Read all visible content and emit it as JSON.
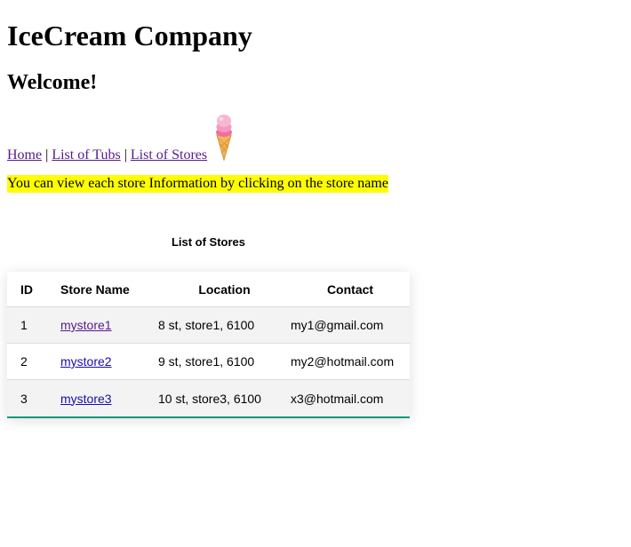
{
  "header": {
    "title": "IceCream Company",
    "welcome": "Welcome!"
  },
  "nav": {
    "home": "Home",
    "sep1": "|",
    "tubs": "List of Tubs",
    "sep2": "|",
    "stores": "List of Stores",
    "logo_icon": "ice-cream-cone-icon"
  },
  "info_text": "You can view each store Information by clicking on the store name",
  "table": {
    "caption": "List of Stores",
    "columns": {
      "id": "ID",
      "name": "Store Name",
      "location": "Location",
      "contact": "Contact"
    },
    "rows": [
      {
        "id": "1",
        "name": "mystore1",
        "location": "8 st, store1, 6100",
        "contact": "my1@gmail.com"
      },
      {
        "id": "2",
        "name": "mystore2",
        "location": "9 st, store1, 6100",
        "contact": "my2@hotmail.com"
      },
      {
        "id": "3",
        "name": "mystore3",
        "location": "10 st, store3, 6100",
        "contact": "x3@hotmail.com"
      }
    ]
  },
  "colors": {
    "highlight": "#ffff00",
    "visited_link": "#551a8b",
    "link": "#1a0dab",
    "table_accent": "#009879",
    "row_stripe": "#f3f3f3"
  }
}
